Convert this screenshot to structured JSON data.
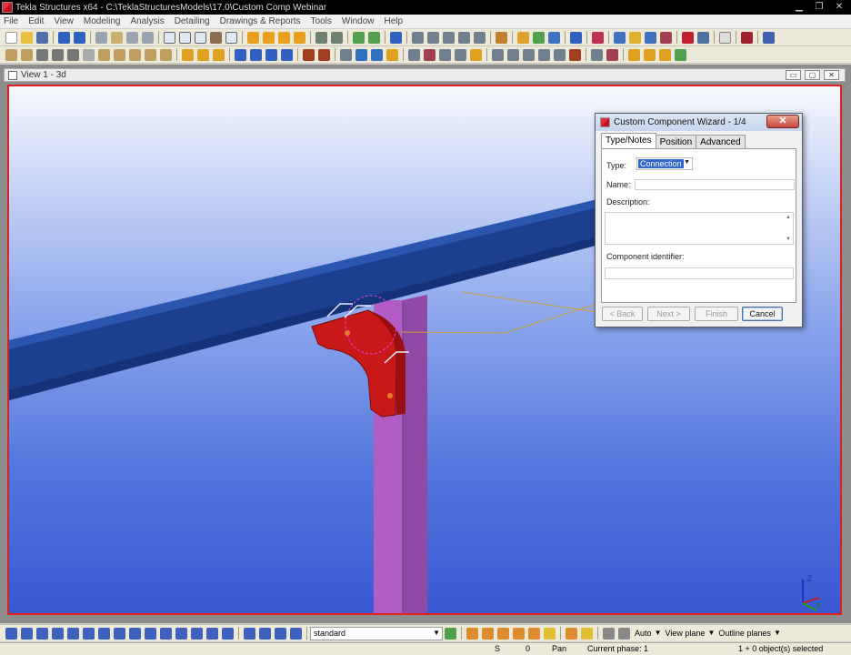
{
  "window": {
    "title": "Tekla Structures x64 - C:\\TeklaStructuresModels\\17.0\\Custom Comp Webinar",
    "min_label": "▁",
    "max_label": "❐",
    "close_label": "✕"
  },
  "menu": [
    "File",
    "Edit",
    "View",
    "Modeling",
    "Analysis",
    "Detailing",
    "Drawings & Reports",
    "Tools",
    "Window",
    "Help"
  ],
  "view": {
    "title": "View 1 - 3d",
    "min_label": "▭",
    "max_label": "▢",
    "close_label": "✕"
  },
  "dialog": {
    "title": "Custom Component Wizard - 1/4",
    "close_label": "✕",
    "tabs": [
      "Type/Notes",
      "Position",
      "Advanced"
    ],
    "active_tab": "Type/Notes",
    "type_label": "Type:",
    "type_value": "Connection",
    "name_label": "Name:",
    "name_value": "",
    "description_label": "Description:",
    "description_value": "",
    "identifier_label": "Component identifier:",
    "identifier_value": "",
    "buttons": {
      "back": "< Back",
      "next": "Next >",
      "finish": "Finish",
      "cancel": "Cancel"
    }
  },
  "bottombar": {
    "phase_filter": "standard",
    "auto_select": "Auto",
    "view_plane": "View plane",
    "outline_planes": "Outline planes"
  },
  "statusbar": {
    "snap": "S",
    "count": "0",
    "mode": "Pan",
    "phase": "Current phase: 1",
    "selection": "1 + 0 object(s) selected"
  },
  "colors": {
    "viewport_border": "#e02020",
    "beam": "#1c3f8f",
    "column": "#b05ec4",
    "connection_plate": "#c81818",
    "selection_highlight": "#3366cc"
  },
  "axis_labels": {
    "z": "Z",
    "y": "y"
  }
}
